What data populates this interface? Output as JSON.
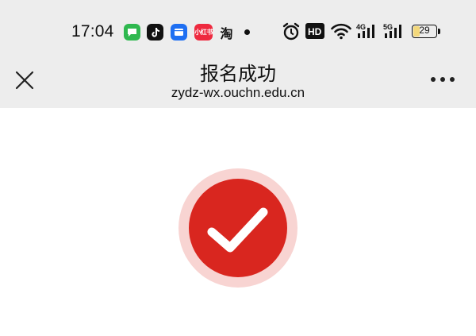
{
  "status_bar": {
    "time": "17:04",
    "notification_icons": [
      "messages-icon",
      "tiktok-icon",
      "files-icon",
      "xiaohongshu-icon",
      "taobao-icon"
    ],
    "xiaohongshu_label": "小红书",
    "taobao_label": "淘",
    "network_4g": "4G",
    "network_5g": "5G",
    "hd_label": "HD",
    "battery": "29",
    "battery_level": 0.29
  },
  "nav": {
    "title": "报名成功",
    "url": "zydz-wx.ouchn.edu.cn"
  },
  "colors": {
    "header_bg": "#ededed",
    "success_red": "#d9261f",
    "success_halo": "#f8d4d2"
  }
}
